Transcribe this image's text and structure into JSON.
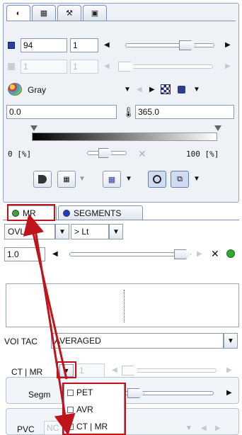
{
  "tabs": [
    {
      "name": "contrast-tab",
      "icon": "◐"
    },
    {
      "name": "layout-tab",
      "icon": "▦"
    },
    {
      "name": "tools-tab",
      "icon": "⚒"
    },
    {
      "name": "save-tab",
      "icon": "▣"
    }
  ],
  "image": {
    "row1_value": "94",
    "row1_count": "1",
    "row2_value": "1",
    "row2_count": "1",
    "colormap": "Gray",
    "min": "0.0",
    "max": "365.0",
    "range_min_label": "0 [%]",
    "range_max_label": "100 [%]"
  },
  "voi_tabs": {
    "mr": "MR",
    "segments": "SEGMENTS"
  },
  "voi": {
    "combo1": "OVL B",
    "combo2": "> Lt",
    "opacity": "1.0",
    "tac_label": "VOI TAC",
    "tac_mode": "AVERAGED"
  },
  "pvc_panel": {
    "source_label": "CT | MR",
    "source_value": "1",
    "segm_label": "Segm"
  },
  "popup": {
    "items": [
      {
        "label": "PET",
        "checked": false
      },
      {
        "label": "AVR",
        "checked": false
      },
      {
        "label": "CT | MR",
        "checked": true
      }
    ]
  },
  "bottom_panel": {
    "label": "PVC",
    "value": "NC"
  },
  "colors": {
    "highlight": "#c0141c",
    "mr_dot": "#3aa83a",
    "segments_dot": "#1f3bd6",
    "green_dot": "#2faa2f"
  }
}
